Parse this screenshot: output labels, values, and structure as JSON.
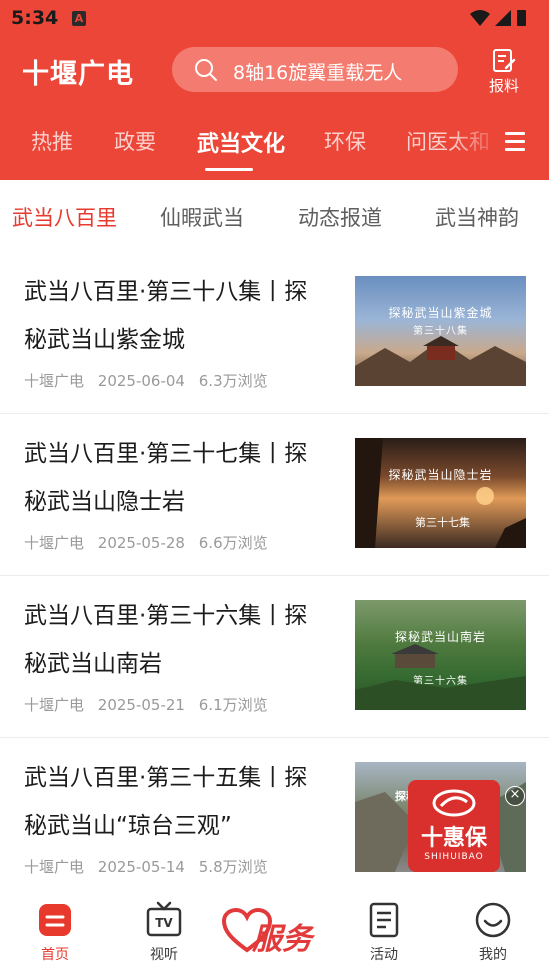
{
  "status_bar": {
    "time": "5:34",
    "notification_icon": "A"
  },
  "header": {
    "logo": "十堰广电",
    "search_placeholder": "8轴16旋翼重载无人",
    "report_label": "报料"
  },
  "tabs": [
    "热推",
    "政要",
    "武当文化",
    "环保",
    "问医太和"
  ],
  "active_tab": "武当文化",
  "subtabs": [
    "武当八百里",
    "仙暇武当",
    "动态报道",
    "武当神韵"
  ],
  "active_subtab": "武当八百里",
  "articles": [
    {
      "title": "武当八百里·第三十八集丨探秘武当山紫金城",
      "source": "十堰广电",
      "date": "2025-06-04",
      "views": "6.3万浏览",
      "thumb_title": "探秘武当山紫金城",
      "thumb_episode": "第三十八集"
    },
    {
      "title": "武当八百里·第三十七集丨探秘武当山隐士岩",
      "source": "十堰广电",
      "date": "2025-05-28",
      "views": "6.6万浏览",
      "thumb_title": "探秘武当山隐士岩",
      "thumb_episode": "第三十七集"
    },
    {
      "title": "武当八百里·第三十六集丨探秘武当山南岩",
      "source": "十堰广电",
      "date": "2025-05-21",
      "views": "6.1万浏览",
      "thumb_title": "探秘武当山南岩",
      "thumb_episode": "第三十六集"
    },
    {
      "title": "武当八百里·第三十五集丨探秘武当山“琼台三观”",
      "source": "十堰广电",
      "date": "2025-05-14",
      "views": "5.8万浏览",
      "thumb_title": "探秘",
      "thumb_episode": ""
    }
  ],
  "ad": {
    "name": "十惠保",
    "subtitle": "SHIHUIBAO"
  },
  "bottom_nav": {
    "home": "首页",
    "tv": "视听",
    "service": "服务",
    "activity": "活动",
    "mine": "我的"
  },
  "colors": {
    "brand_red": "#eb4637",
    "active_red": "#e83a2c"
  }
}
